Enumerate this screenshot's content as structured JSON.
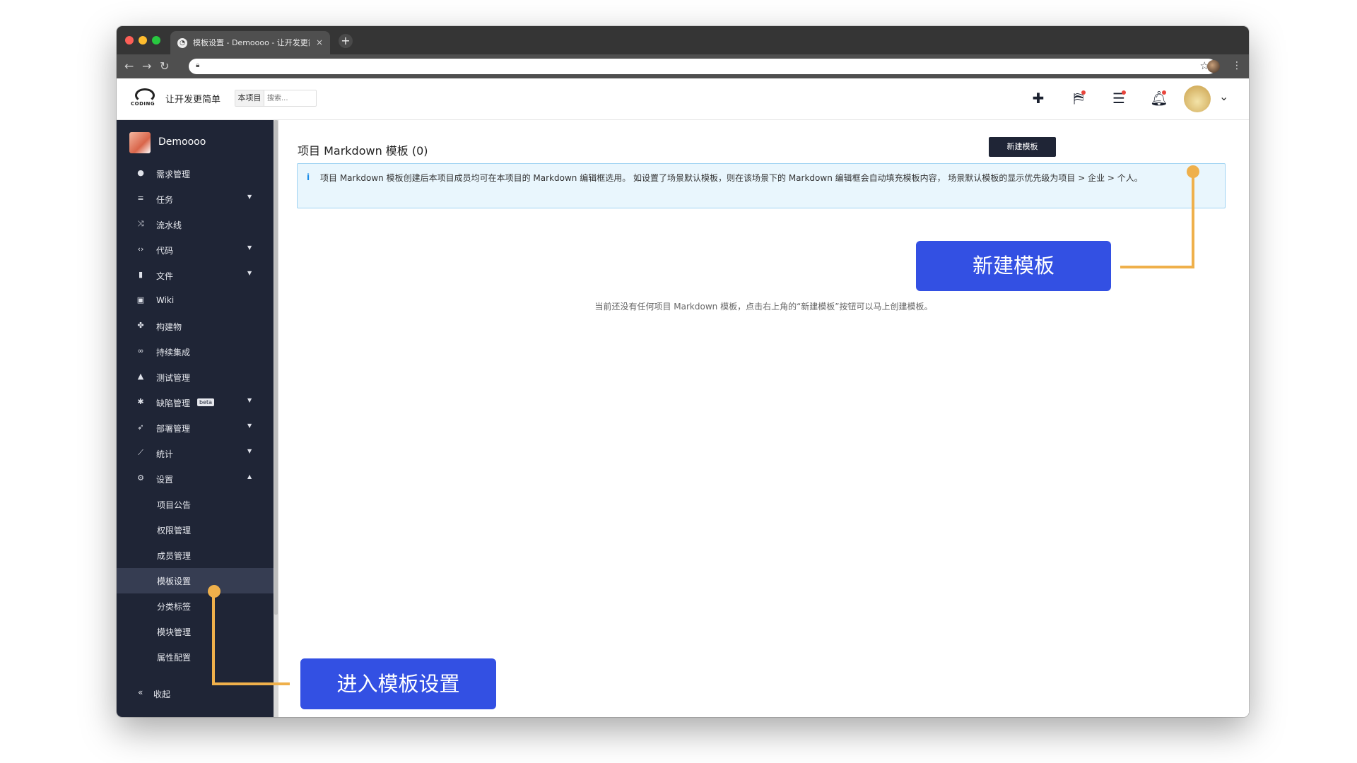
{
  "browser": {
    "tab_title": "模板设置 - Demoooo - 让开发更简单",
    "tab_close": "×",
    "new_tab": "+",
    "back": "←",
    "forward": "→",
    "reload": "↻",
    "menu": "⋮"
  },
  "header": {
    "logo_text": "CODING",
    "slogan": "让开发更简单",
    "search_scope": "本项目",
    "search_placeholder": "搜索..."
  },
  "sidebar": {
    "project_name": "Demoooo",
    "items": [
      {
        "icon": "lightbulb-icon",
        "glyph": "●",
        "label": "需求管理",
        "has_arrow": false
      },
      {
        "icon": "task-icon",
        "glyph": "≡",
        "label": "任务",
        "has_arrow": true
      },
      {
        "icon": "shuffle-icon",
        "glyph": "⤨",
        "label": "流水线",
        "has_arrow": false
      },
      {
        "icon": "code-icon",
        "glyph": "‹›",
        "label": "代码",
        "has_arrow": true
      },
      {
        "icon": "file-icon",
        "glyph": "▮",
        "label": "文件",
        "has_arrow": true
      },
      {
        "icon": "wiki-icon",
        "glyph": "▣",
        "label": "Wiki",
        "has_arrow": false
      },
      {
        "icon": "artifact-icon",
        "glyph": "✤",
        "label": "构建物",
        "has_arrow": false
      },
      {
        "icon": "infinity-icon",
        "glyph": "∞",
        "label": "持续集成",
        "has_arrow": false
      },
      {
        "icon": "flask-icon",
        "glyph": "▲",
        "label": "测试管理",
        "has_arrow": false
      },
      {
        "icon": "bug-icon",
        "glyph": "✱",
        "label": "缺陷管理",
        "has_arrow": true,
        "badge": "beta"
      },
      {
        "icon": "rocket-icon",
        "glyph": "➶",
        "label": "部署管理",
        "has_arrow": true
      },
      {
        "icon": "chart-icon",
        "glyph": "⟋",
        "label": "统计",
        "has_arrow": true
      },
      {
        "icon": "gear-icon",
        "glyph": "⚙",
        "label": "设置",
        "has_arrow": true,
        "expanded": true
      }
    ],
    "settings_sub": [
      "项目公告",
      "权限管理",
      "成员管理",
      "模板设置",
      "分类标签",
      "模块管理",
      "属性配置"
    ],
    "active_sub": "模板设置",
    "collapse_icon": "«",
    "collapse_label": "收起"
  },
  "main": {
    "title": "项目 Markdown 模板 (0)",
    "new_button": "新建模板",
    "info_icon": "i",
    "notice": "项目 Markdown 模板创建后本项目成员均可在本项目的 Markdown 编辑框选用。 如设置了场景默认模板，则在该场景下的 Markdown 编辑框会自动填充模板内容， 场景默认模板的显示优先级为项目 > 企业 > 个人。",
    "empty_text": "当前还没有任何项目 Markdown 模板，点击右上角的“新建模板”按钮可以马上创建模板。"
  },
  "annotations": {
    "new_template": "新建模板",
    "enter_settings": "进入模板设置"
  },
  "colors": {
    "sidebar_bg": "#1f2536",
    "callout_bg": "#3350e3",
    "annotation_line": "#efb04b",
    "notice_bg": "#e9f6fd",
    "notice_border": "#9fd3f2"
  }
}
